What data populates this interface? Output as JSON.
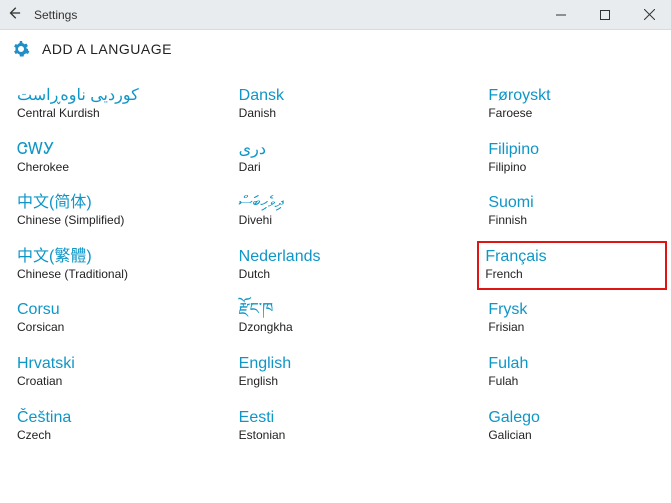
{
  "window": {
    "title": "Settings"
  },
  "page": {
    "heading": "ADD A LANGUAGE"
  },
  "languages": [
    {
      "native": "کوردیی ناوەڕاست",
      "english": "Central Kurdish",
      "col": 1
    },
    {
      "native": "ᏣᎳᎩ",
      "english": "Cherokee",
      "col": 1
    },
    {
      "native": "中文(简体)",
      "english": "Chinese (Simplified)",
      "col": 1
    },
    {
      "native": "中文(繁體)",
      "english": "Chinese (Traditional)",
      "col": 1
    },
    {
      "native": "Corsu",
      "english": "Corsican",
      "col": 1
    },
    {
      "native": "Hrvatski",
      "english": "Croatian",
      "col": 1
    },
    {
      "native": "Čeština",
      "english": "Czech",
      "col": 1
    },
    {
      "native": "Dansk",
      "english": "Danish",
      "col": 2
    },
    {
      "native": "درى",
      "english": "Dari",
      "col": 2
    },
    {
      "native": "ދިވެހިބަސް",
      "english": "Divehi",
      "col": 2
    },
    {
      "native": "Nederlands",
      "english": "Dutch",
      "col": 2
    },
    {
      "native": "རྫོང་ཁ",
      "english": "Dzongkha",
      "col": 2
    },
    {
      "native": "English",
      "english": "English",
      "col": 2
    },
    {
      "native": "Eesti",
      "english": "Estonian",
      "col": 2
    },
    {
      "native": "Føroyskt",
      "english": "Faroese",
      "col": 3
    },
    {
      "native": "Filipino",
      "english": "Filipino",
      "col": 3
    },
    {
      "native": "Suomi",
      "english": "Finnish",
      "col": 3
    },
    {
      "native": "Français",
      "english": "French",
      "col": 3,
      "highlighted": true
    },
    {
      "native": "Frysk",
      "english": "Frisian",
      "col": 3
    },
    {
      "native": "Fulah",
      "english": "Fulah",
      "col": 3
    },
    {
      "native": "Galego",
      "english": "Galician",
      "col": 3
    }
  ]
}
